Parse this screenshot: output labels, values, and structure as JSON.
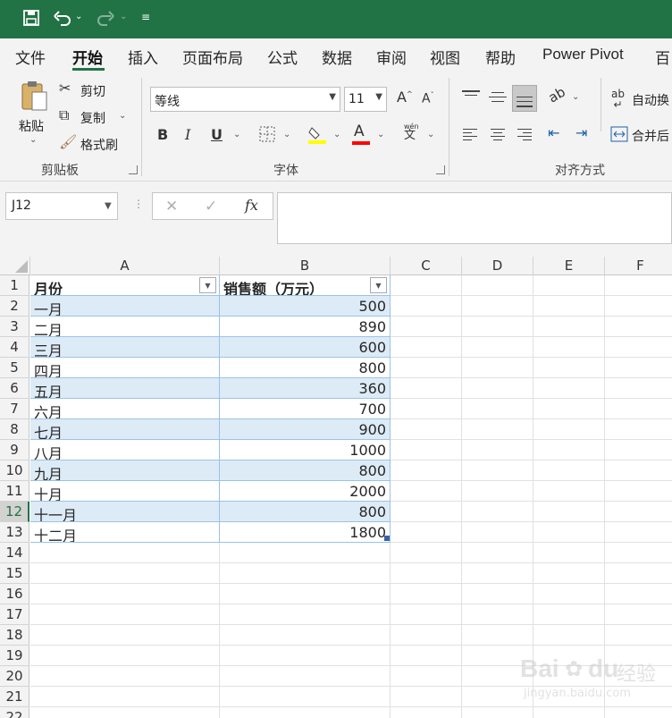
{
  "titlebar": {
    "bg_color": "#217346",
    "undo_icon": "undo-icon",
    "redo_icon": "redo-icon",
    "save_icon": "save-icon"
  },
  "menu": {
    "tabs": [
      "文件",
      "开始",
      "插入",
      "页面布局",
      "公式",
      "数据",
      "审阅",
      "视图",
      "帮助",
      "Power Pivot",
      "百"
    ],
    "active": "开始"
  },
  "ribbon": {
    "clipboard": {
      "paste": "粘贴",
      "cut": "剪切",
      "copy": "复制",
      "format_painter": "格式刷",
      "group": "剪贴板"
    },
    "font": {
      "name": "等线",
      "size": "11",
      "bold": "B",
      "italic": "I",
      "underline": "U",
      "font_color_letter": "A",
      "phonetic": "文",
      "phonetic_top": "wén",
      "group": "字体"
    },
    "alignment": {
      "wrap": "自动换",
      "merge": "合并后",
      "group": "对齐方式"
    }
  },
  "formula_bar": {
    "name_box": "J12",
    "fx": "fx",
    "cancel": "✕",
    "enter": "✓",
    "value": ""
  },
  "grid": {
    "columns": [
      "A",
      "B",
      "C",
      "D",
      "E",
      "F"
    ],
    "rows": [
      "1",
      "2",
      "3",
      "4",
      "5",
      "6",
      "7",
      "8",
      "9",
      "10",
      "11",
      "12",
      "13",
      "14",
      "15",
      "16",
      "17",
      "18",
      "19",
      "20",
      "21",
      "22"
    ],
    "selected_row": "12",
    "table_header": [
      "月份",
      "销售额（万元）"
    ],
    "table_rows": [
      [
        "一月",
        "500"
      ],
      [
        "二月",
        "890"
      ],
      [
        "三月",
        "600"
      ],
      [
        "四月",
        "800"
      ],
      [
        "五月",
        "360"
      ],
      [
        "六月",
        "700"
      ],
      [
        "七月",
        "900"
      ],
      [
        "八月",
        "1000"
      ],
      [
        "九月",
        "800"
      ],
      [
        "十月",
        "2000"
      ],
      [
        "十一月",
        "800"
      ],
      [
        "十二月",
        "1800"
      ]
    ],
    "band_color": "#ddebf7",
    "accent_color": "#217346"
  },
  "watermark": {
    "brand": "Bai",
    "brand2": "du",
    "cn": "经验",
    "url": "jingyan.baidu.com"
  }
}
